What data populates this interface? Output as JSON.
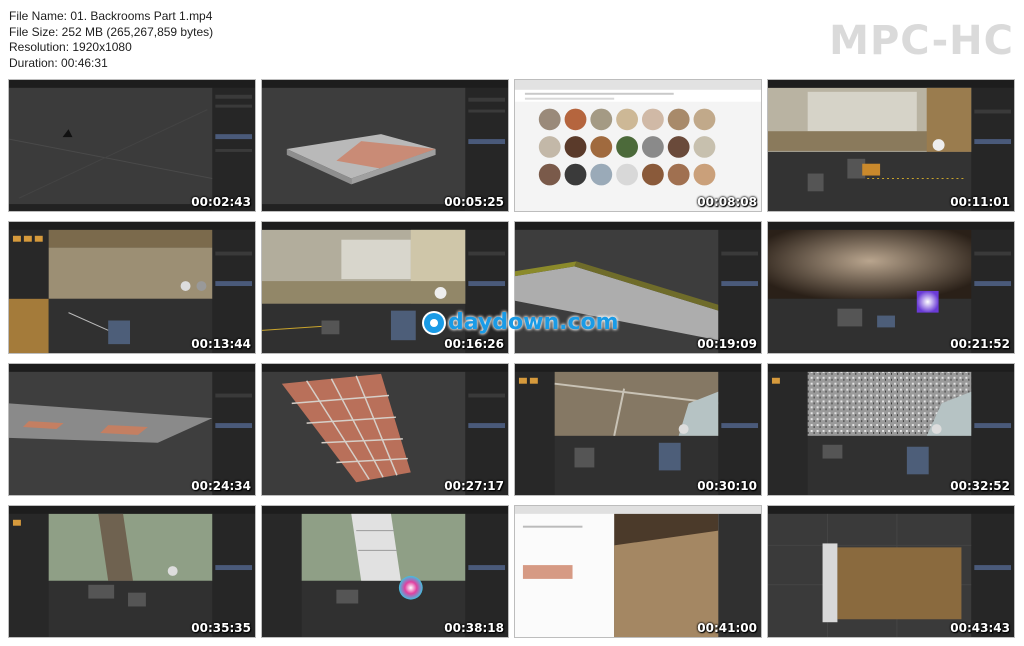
{
  "header": {
    "file_name": "File Name: 01. Backrooms Part 1.mp4",
    "file_size": "File Size: 252 MB (265,267,859 bytes)",
    "resolution": "Resolution: 1920x1080",
    "duration": "Duration: 00:46:31"
  },
  "brand": "MPC-HC",
  "watermark": "daydown.com",
  "thumbnails": [
    {
      "time": "00:02:43"
    },
    {
      "time": "00:05:25"
    },
    {
      "time": "00:08:08"
    },
    {
      "time": "00:11:01"
    },
    {
      "time": "00:13:44"
    },
    {
      "time": "00:16:26"
    },
    {
      "time": "00:19:09"
    },
    {
      "time": "00:21:52"
    },
    {
      "time": "00:24:34"
    },
    {
      "time": "00:27:17"
    },
    {
      "time": "00:30:10"
    },
    {
      "time": "00:32:52"
    },
    {
      "time": "00:35:35"
    },
    {
      "time": "00:38:18"
    },
    {
      "time": "00:41:00"
    },
    {
      "time": "00:43:43"
    }
  ],
  "colors": {
    "accent_blue": "#1a9be6",
    "ui_dark": "#2b2b2b",
    "brand_gray": "#dadada"
  }
}
